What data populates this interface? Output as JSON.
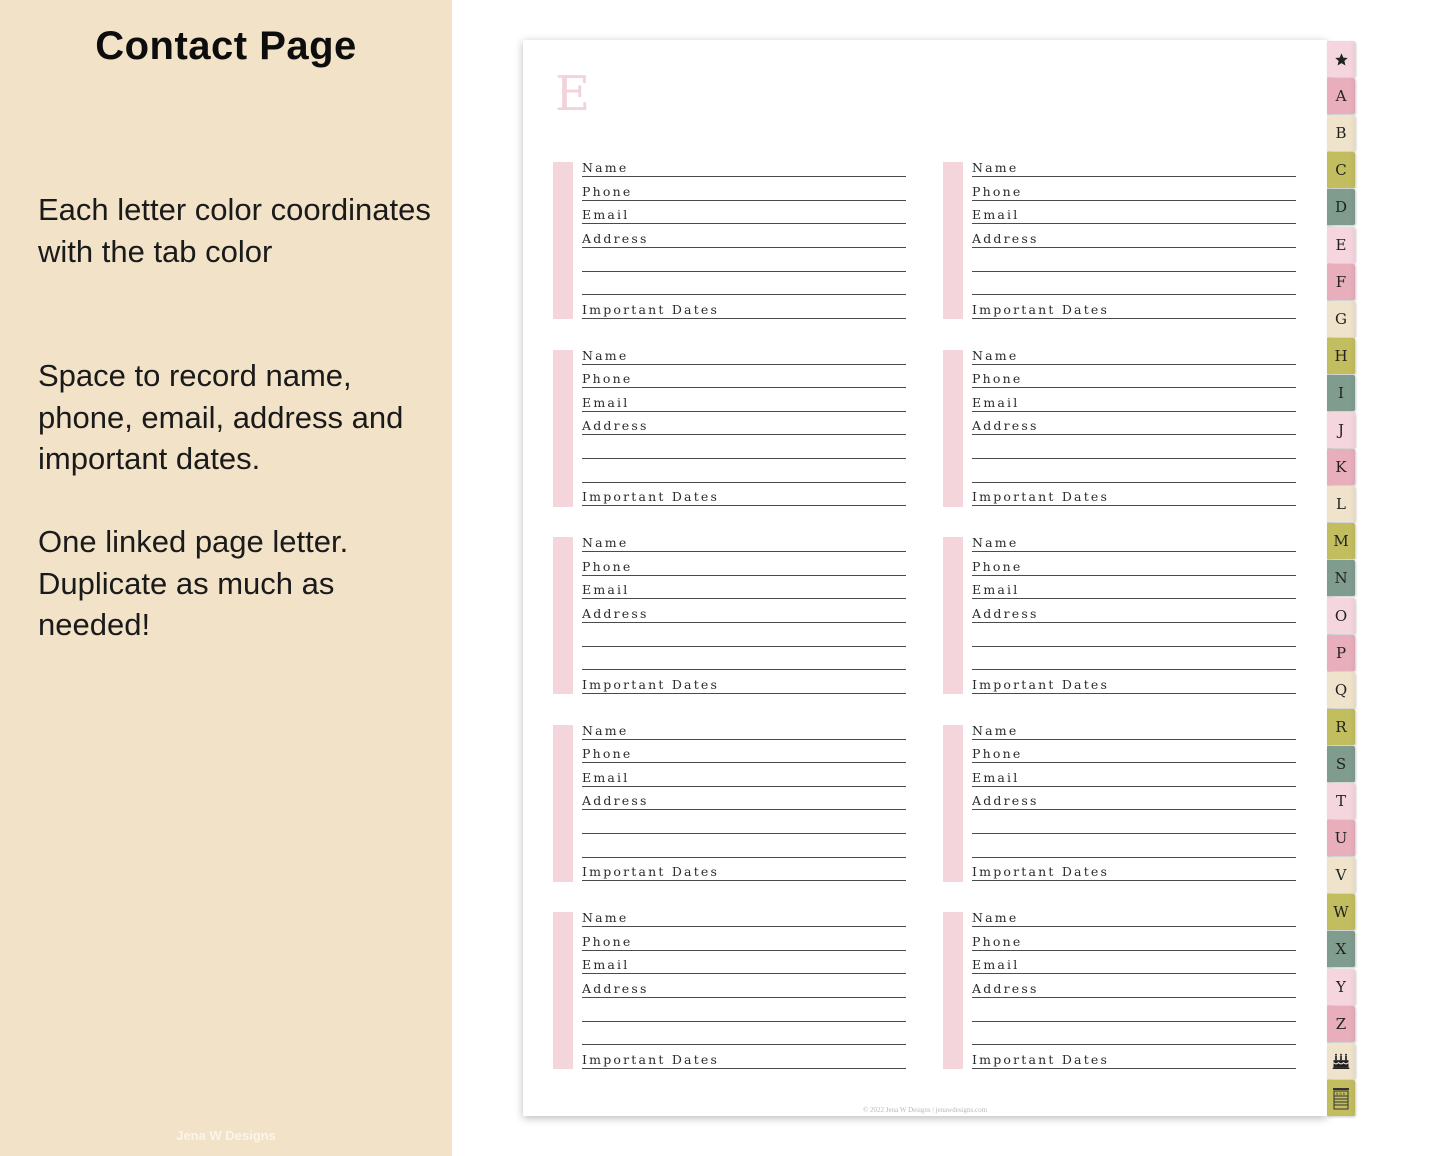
{
  "left_panel": {
    "title": "Contact Page",
    "paragraphs": [
      "Each letter color coordinates with the tab color",
      "Space to record name, phone, email, address and important dates.",
      "One linked page letter. Duplicate as much as needed!"
    ],
    "watermark": "Jena W Designs",
    "background_color": "#f1e2c8"
  },
  "page": {
    "letter": "E",
    "letter_color": "#f3d3da",
    "accent_bar_color": "#f3d5db",
    "footer": "© 2022 Jena W Designs | jenawdesigns.com",
    "field_labels": {
      "name": "Name",
      "phone": "Phone",
      "email": "Email",
      "address": "Address",
      "address_line_2": "",
      "address_line_3": "",
      "important_dates": "Important Dates"
    },
    "contact_blocks_per_column": 5,
    "columns": 2
  },
  "tabs": [
    {
      "label": "★",
      "icon": "star-icon",
      "color": "#f5d6de"
    },
    {
      "label": "A",
      "color": "#e8aebb"
    },
    {
      "label": "B",
      "color": "#efe3cb"
    },
    {
      "label": "C",
      "color": "#c2bd5e"
    },
    {
      "label": "D",
      "color": "#7f9c8e"
    },
    {
      "label": "E",
      "color": "#f5d6de"
    },
    {
      "label": "F",
      "color": "#e8aebb"
    },
    {
      "label": "G",
      "color": "#efe3cb"
    },
    {
      "label": "H",
      "color": "#c2bd5e"
    },
    {
      "label": "I",
      "color": "#7f9c8e"
    },
    {
      "label": "J",
      "color": "#f5d6de"
    },
    {
      "label": "K",
      "color": "#e8aebb"
    },
    {
      "label": "L",
      "color": "#efe3cb"
    },
    {
      "label": "M",
      "color": "#c2bd5e"
    },
    {
      "label": "N",
      "color": "#7f9c8e"
    },
    {
      "label": "O",
      "color": "#f5d6de"
    },
    {
      "label": "P",
      "color": "#e8aebb"
    },
    {
      "label": "Q",
      "color": "#efe3cb"
    },
    {
      "label": "R",
      "color": "#c2bd5e"
    },
    {
      "label": "S",
      "color": "#7f9c8e"
    },
    {
      "label": "T",
      "color": "#f5d6de"
    },
    {
      "label": "U",
      "color": "#e8aebb"
    },
    {
      "label": "V",
      "color": "#efe3cb"
    },
    {
      "label": "W",
      "color": "#c2bd5e"
    },
    {
      "label": "X",
      "color": "#7f9c8e"
    },
    {
      "label": "Y",
      "color": "#f5d6de"
    },
    {
      "label": "Z",
      "color": "#e8aebb"
    },
    {
      "label": "",
      "icon": "birthday-cake-icon",
      "color": "#efe3cb"
    },
    {
      "label": "",
      "icon": "notes-icon",
      "color": "#c2bd5e"
    }
  ]
}
